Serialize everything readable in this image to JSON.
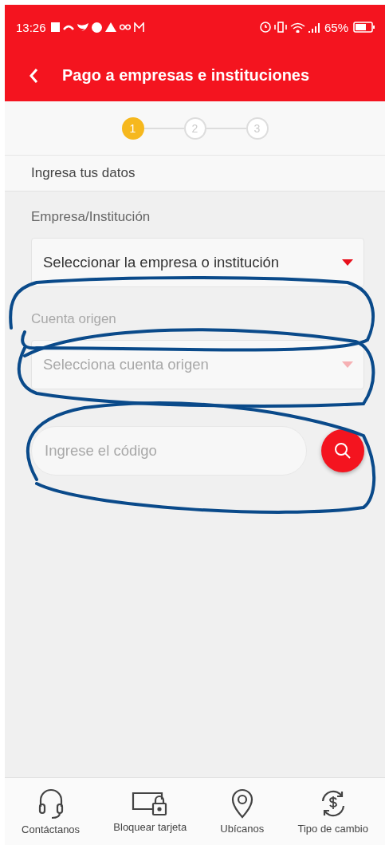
{
  "status_bar": {
    "time": "13:26",
    "battery": "65%"
  },
  "app_bar": {
    "title": "Pago a empresas e instituciones"
  },
  "stepper": [
    {
      "label": "1",
      "selected": true
    },
    {
      "label": "2",
      "selected": false
    },
    {
      "label": "3",
      "selected": false
    }
  ],
  "section_title": "Ingresa tus datos",
  "form": [
    {
      "kind": "select",
      "label": "Empresa/Institución",
      "value": "Seleccionar la empresa o institución",
      "disabled": false
    },
    {
      "kind": "select",
      "label": "Cuenta origen",
      "value": "Selecciona cuenta origen",
      "disabled": true
    },
    {
      "kind": "search",
      "placeholder": "Ingrese el código",
      "disabled": true
    }
  ],
  "bottom_nav": [
    {
      "kind": "headset",
      "label": "Contáctanos"
    },
    {
      "kind": "lock-card",
      "label": "Bloquear tarjeta"
    },
    {
      "kind": "pin",
      "label": "Ubícanos"
    },
    {
      "kind": "exchange",
      "label": "Tipo de cambio"
    }
  ]
}
